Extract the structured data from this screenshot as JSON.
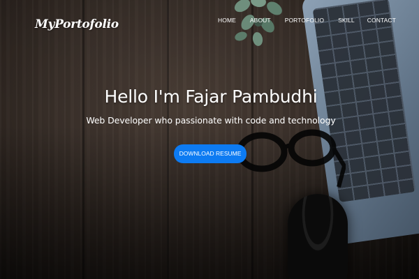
{
  "brand": {
    "name": "MyPortofolio"
  },
  "nav": {
    "items": [
      {
        "label": "HOME"
      },
      {
        "label": "ABOUT"
      },
      {
        "label": "PORTOFOLIO"
      },
      {
        "label": "SKILL"
      },
      {
        "label": "CONTACT"
      }
    ]
  },
  "hero": {
    "title": "Hello I'm Fajar Pambudhi",
    "subtitle": "Web Developer who passionate with code and technology",
    "cta_label": "DOWNLOAD RESUME"
  },
  "colors": {
    "accent": "#0d7bf2",
    "text": "#ffffff",
    "background": "#3a302a"
  },
  "icons": {
    "decor": [
      "laptop-illustration",
      "plant-illustration",
      "eyeglasses-illustration",
      "coffee-mug-illustration"
    ]
  }
}
